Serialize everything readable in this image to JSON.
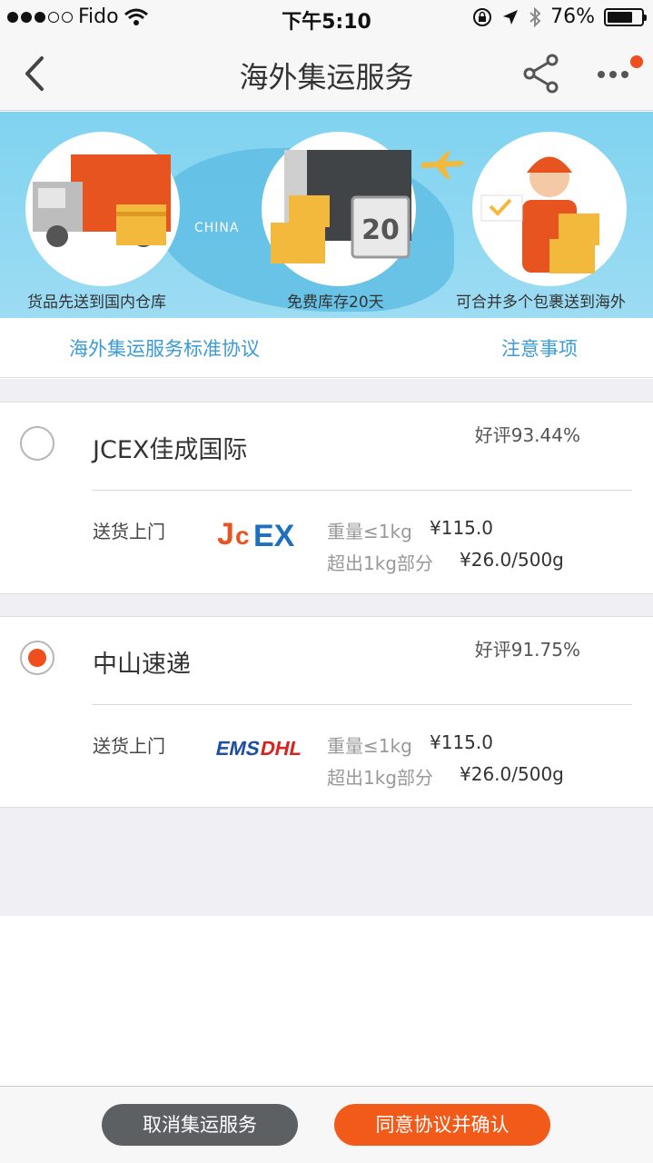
{
  "status_bar": {
    "carrier": "Fido",
    "time": "下午5:10",
    "battery": "76%",
    "battery_level": 0.76
  },
  "nav": {
    "title": "海外集运服务",
    "back_icon": "chevron-left-icon",
    "share_icon": "share-icon",
    "more_icon": "more-icon"
  },
  "banner": {
    "map_label": "CHINA",
    "steps": [
      {
        "label": "货品先送到国内仓库"
      },
      {
        "label": "免费库存20天",
        "badge": "20"
      },
      {
        "label": "可合并多个包裹送到海外"
      }
    ]
  },
  "links": {
    "protocol": "海外集运服务标准协议",
    "notes": "注意事项"
  },
  "carriers": [
    {
      "name": "JCEX佳成国际",
      "rating": "好评93.44%",
      "selected": false,
      "delivery": "送货上门",
      "weight_label": "重量≤1kg",
      "weight_price": "¥115.0",
      "extra_label": "超出1kg部分",
      "extra_price": "¥26.0/500g"
    },
    {
      "name": "中山速递",
      "rating": "好评91.75%",
      "selected": true,
      "delivery": "送货上门",
      "weight_label": "重量≤1kg",
      "weight_price": "¥115.0",
      "extra_label": "超出1kg部分",
      "extra_price": "¥26.0/500g"
    }
  ],
  "buttons": {
    "cancel": "取消集运服务",
    "confirm": "同意协议并确认"
  },
  "colors": {
    "accent": "#f25a1a",
    "link": "#3a9bd6",
    "banner": "#8fd8f2"
  }
}
